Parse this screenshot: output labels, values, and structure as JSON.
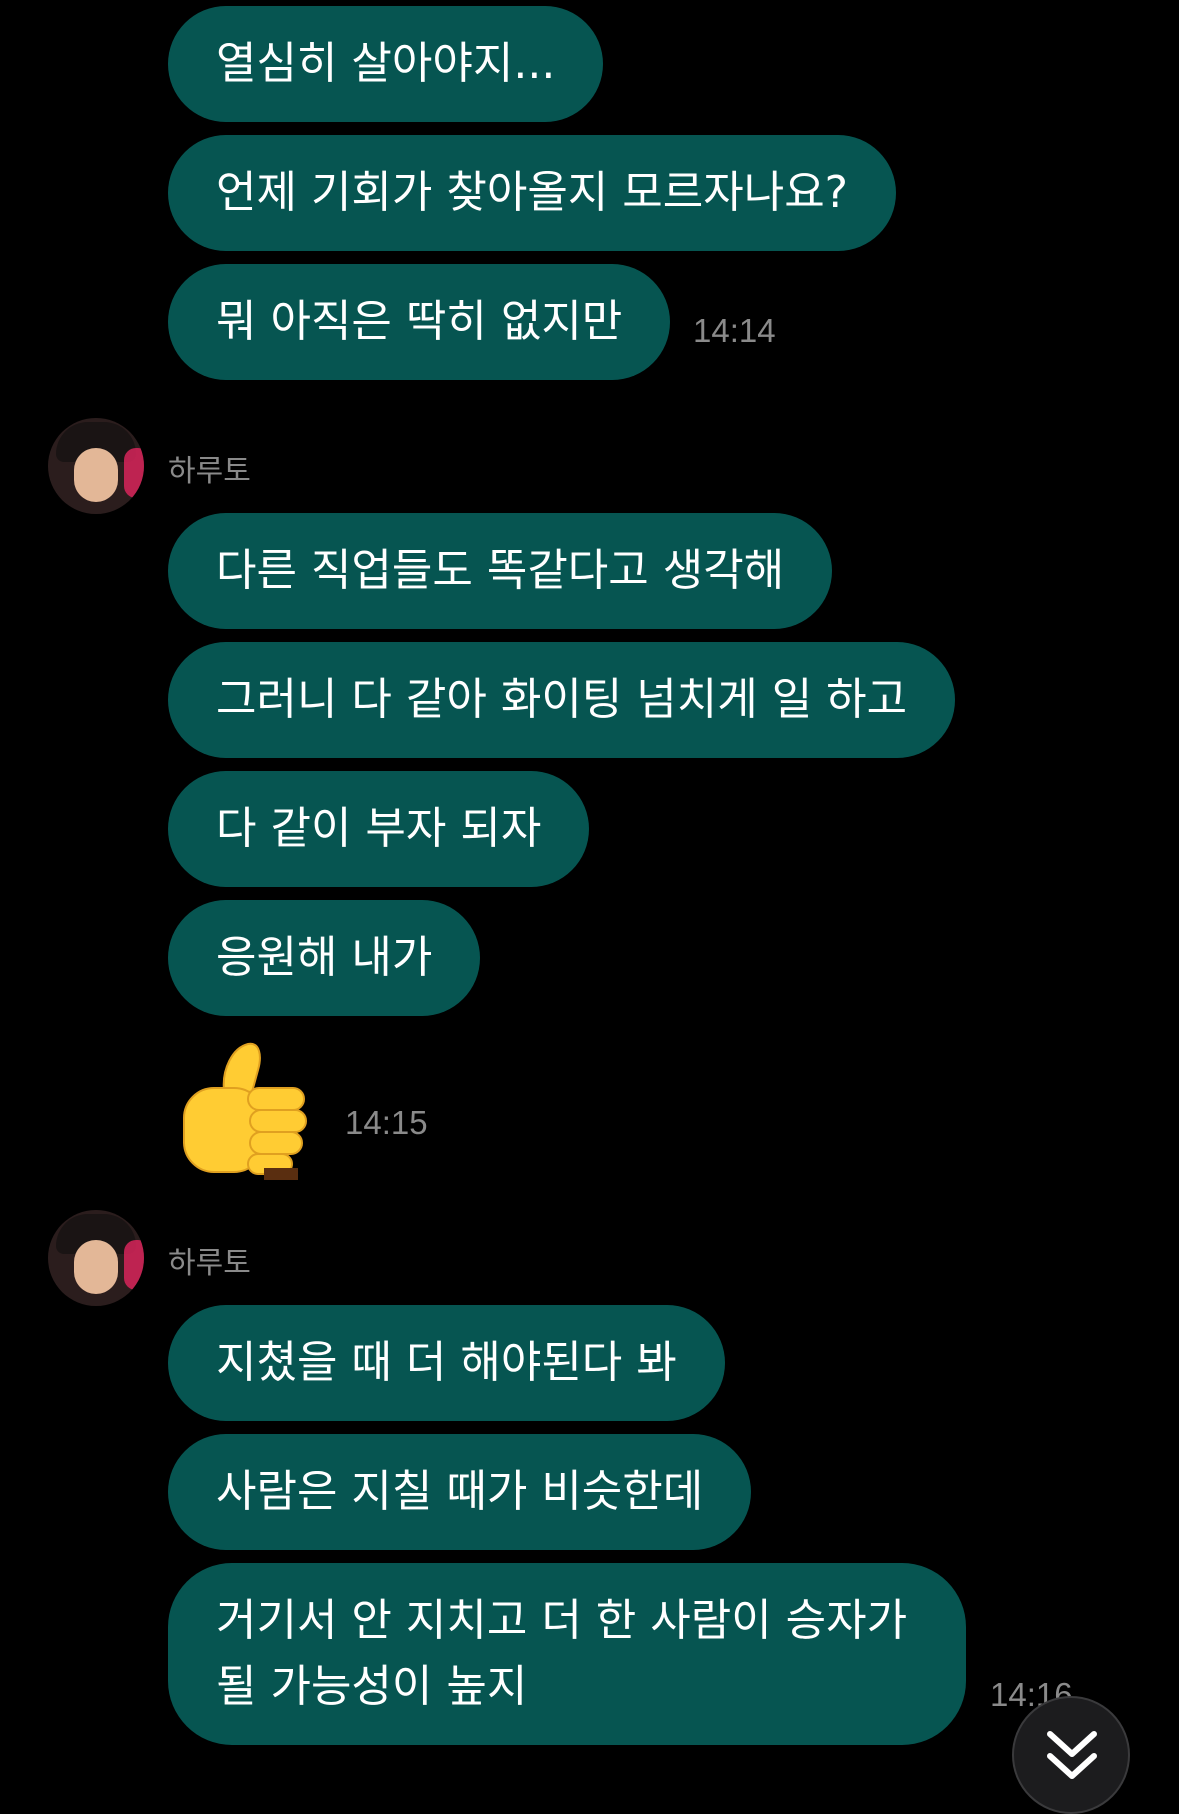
{
  "messages_group_1": [
    {
      "text": "열심히 살아야지..."
    },
    {
      "text": "언제 기회가 찾아올지 모르자나요?"
    },
    {
      "text": "뭐 아직은 딱히 없지만"
    }
  ],
  "timestamp_1": "14:14",
  "sender_2": "하루토",
  "messages_group_2": [
    {
      "text": "다른 직업들도 똑같다고 생각해"
    },
    {
      "text": "그러니 다 같아 화이팅 넘치게 일 하고"
    },
    {
      "text": "다 같이 부자 되자"
    },
    {
      "text": "응원해 내가"
    }
  ],
  "emoji_message": {
    "icon": "thumbs-up-icon"
  },
  "timestamp_2": "14:15",
  "sender_3": "하루토",
  "messages_group_3": [
    {
      "text": "지쳤을 때 더 해야된다 봐"
    },
    {
      "text": "사람은 지칠 때가 비슷한데"
    },
    {
      "line1": "거기서 안 지치고 더 한 사람이 승자가",
      "line2": "될 가능성이 높지"
    }
  ],
  "timestamp_3": "14:16",
  "colors": {
    "bubble": "#065551",
    "background": "#000000",
    "timestamp": "#8a8a8a"
  }
}
